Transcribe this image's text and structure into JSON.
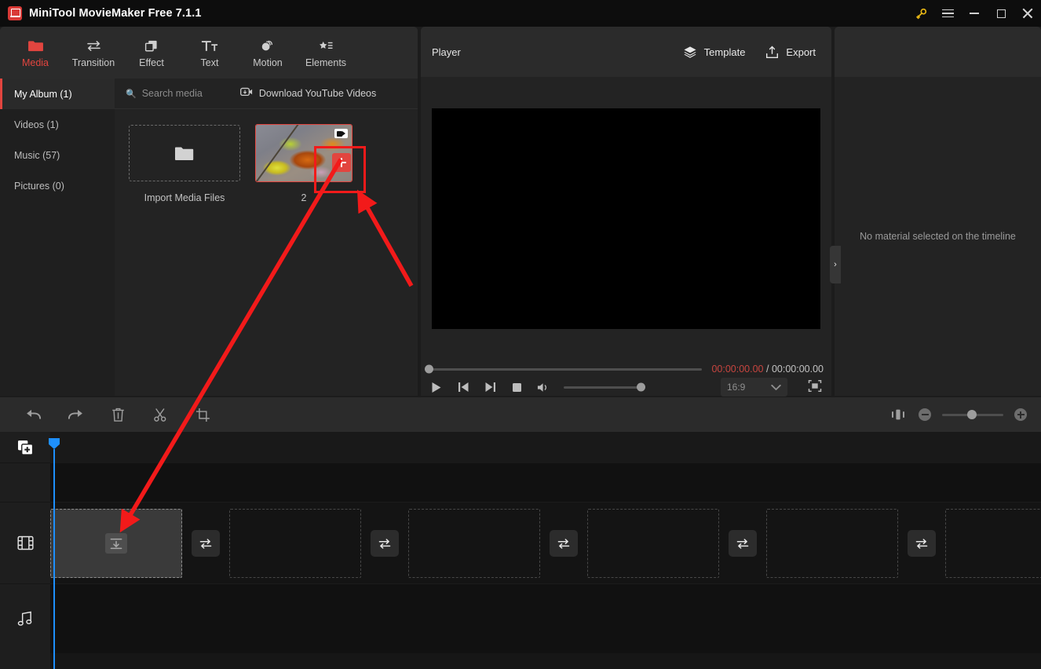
{
  "window": {
    "title": "MiniTool MovieMaker Free 7.1.1",
    "logo_icon": "minitool-logo-icon",
    "controls": [
      {
        "name": "license-key-button",
        "icon": "key-icon",
        "label": "⚿"
      },
      {
        "name": "main-menu-button",
        "icon": "hamburger-icon",
        "label": ""
      },
      {
        "name": "minimize-button",
        "icon": "minimize-icon",
        "label": ""
      },
      {
        "name": "maximize-button",
        "icon": "maximize-icon",
        "label": ""
      },
      {
        "name": "close-button",
        "icon": "close-icon",
        "label": ""
      }
    ]
  },
  "tabs": [
    {
      "label": "Media",
      "icon": "folder-icon",
      "active": true
    },
    {
      "label": "Transition",
      "icon": "transition-icon",
      "active": false
    },
    {
      "label": "Effect",
      "icon": "effect-icon",
      "active": false
    },
    {
      "label": "Text",
      "icon": "text-icon",
      "active": false
    },
    {
      "label": "Motion",
      "icon": "motion-icon",
      "active": false
    },
    {
      "label": "Elements",
      "icon": "elements-icon",
      "active": false
    }
  ],
  "media": {
    "albums": [
      {
        "label": "My Album (1)",
        "selected": true
      },
      {
        "label": "Videos (1)",
        "selected": false
      },
      {
        "label": "Music (57)",
        "selected": false
      },
      {
        "label": "Pictures (0)",
        "selected": false
      }
    ],
    "search_placeholder": "Search media",
    "search_icon": "search-icon",
    "download_youtube_label": "Download YouTube Videos",
    "download_youtube_icon": "youtube-download-icon",
    "import_label": "Import Media Files",
    "import_icon": "folder-open-icon",
    "clip": {
      "duration_label": "2",
      "video_badge_icon": "video-camera-icon",
      "add_icon": "plus-icon"
    }
  },
  "player": {
    "title": "Player",
    "template_label": "Template",
    "template_icon": "layers-icon",
    "export_label": "Export",
    "export_icon": "export-upload-icon",
    "current_time": "00:00:00.00",
    "time_separator": "/",
    "total_time": "00:00:00.00",
    "aspect_ratio": "16:9",
    "controls": [
      {
        "name": "play-button",
        "icon": "play-icon"
      },
      {
        "name": "prev-frame-button",
        "icon": "skip-back-icon"
      },
      {
        "name": "next-frame-button",
        "icon": "skip-forward-icon"
      },
      {
        "name": "stop-button",
        "icon": "stop-icon"
      },
      {
        "name": "volume-button",
        "icon": "speaker-icon"
      }
    ],
    "fullscreen_icon": "fullscreen-icon",
    "accent_time_color": "#c7453f"
  },
  "right_panel": {
    "empty_message": "No material selected on the timeline",
    "collapse_icon": "chevron-right-icon",
    "collapse_glyph": "›"
  },
  "timeline": {
    "toolbar": [
      {
        "name": "undo-button",
        "icon": "undo-icon"
      },
      {
        "name": "redo-button",
        "icon": "redo-icon"
      },
      {
        "name": "delete-button",
        "icon": "trash-icon"
      },
      {
        "name": "split-button",
        "icon": "scissors-icon"
      },
      {
        "name": "crop-button",
        "icon": "crop-icon"
      }
    ],
    "zoom": {
      "fit_icon": "fit-to-timeline-icon",
      "zoom_out_icon": "zoom-out-icon",
      "zoom_in_icon": "zoom-in-icon"
    },
    "gutter": [
      {
        "name": "add-media-track-icon",
        "icon": "add-media-icon"
      },
      {
        "name": "video-track-icon",
        "icon": "film-strip-icon"
      },
      {
        "name": "audio-track-icon",
        "icon": "music-note-icon"
      }
    ],
    "video_track": {
      "drop_icon": "drop-here-icon",
      "transition_icon": "transition-swap-icon",
      "slot_count": 6,
      "transition_count": 5
    },
    "playhead_color": "#1e8ffb"
  },
  "annotations": {
    "highlight_color": "#f21a1a",
    "box_label": "add-to-timeline-highlight",
    "arrows": [
      {
        "name": "arrow-to-add-button"
      },
      {
        "name": "arrow-to-timeline-slot"
      }
    ]
  }
}
